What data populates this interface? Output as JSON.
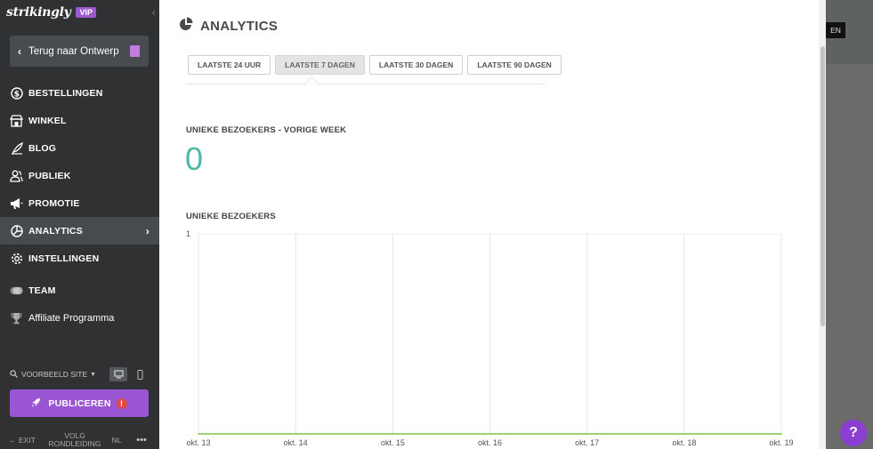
{
  "sidebar": {
    "logo": "strikingly",
    "vip": "VIP",
    "back": "Terug naar Ontwerp",
    "items": [
      {
        "label": "BESTELLINGEN",
        "icon": "dollar-icon"
      },
      {
        "label": "WINKEL",
        "icon": "store-icon"
      },
      {
        "label": "BLOG",
        "icon": "quill-icon"
      },
      {
        "label": "PUBLIEK",
        "icon": "people-icon"
      },
      {
        "label": "PROMOTIE",
        "icon": "megaphone-icon"
      },
      {
        "label": "ANALYTICS",
        "icon": "pie-chart-icon"
      },
      {
        "label": "INSTELLINGEN",
        "icon": "gear-icon"
      },
      {
        "label": "TEAM",
        "icon": "team-icon"
      },
      {
        "label": "Affiliate Programma",
        "icon": "trophy-icon"
      }
    ],
    "preview": "VOORBEELD SITE",
    "publish": "PUBLICEREN",
    "bottom": {
      "exit": "EXIT",
      "tour_line1": "VOLG",
      "tour_line2": "RONDLEIDING",
      "lang": "NL",
      "more": "•••"
    }
  },
  "main": {
    "title": "ANALYTICS",
    "tabs": [
      "LAATSTE 24 UUR",
      "LAATSTE 7 DAGEN",
      "LAATSTE 30 DAGEN",
      "LAATSTE 90 DAGEN"
    ],
    "active_tab": 1,
    "weekly_label": "UNIEKE BEZOEKERS - VORIGE WEEK",
    "weekly_value": "0",
    "chart_label": "UNIEKE BEZOEKERS"
  },
  "right": {
    "chip": "EN"
  },
  "help": "?",
  "colors": {
    "accent": "#9a55d3",
    "number": "#4cb9a4",
    "line": "#7dc242"
  },
  "chart_data": {
    "type": "line",
    "categories": [
      "okt. 13",
      "okt. 14",
      "okt. 15",
      "okt. 16",
      "okt. 17",
      "okt. 18",
      "okt. 19"
    ],
    "series": [
      {
        "values": [
          0,
          0,
          0,
          0,
          0,
          0,
          0
        ]
      }
    ],
    "ylim": [
      0,
      1
    ],
    "yticks": [
      "1"
    ],
    "grid": true
  }
}
